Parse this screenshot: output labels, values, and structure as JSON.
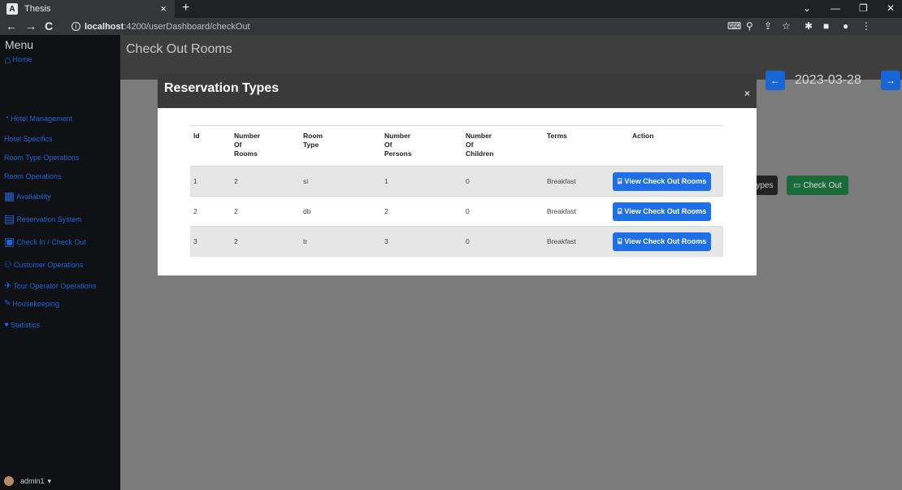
{
  "browser": {
    "tab_title": "Thesis",
    "tab_favicon": "A",
    "tab_close": "×",
    "new_tab": "+",
    "url_host": "localhost",
    "url_path": ":4200/userDashboard/checkOut",
    "window_min": "—",
    "window_restore": "❐",
    "window_close": "✕",
    "chevron": "⌄"
  },
  "sidebar": {
    "menu_title": "Menu",
    "items": [
      {
        "label": "Home",
        "icon": "home-icon"
      },
      {
        "label": "Hotel Management",
        "icon": "dashboard-icon"
      },
      {
        "label": "Hotel Specifics",
        "icon": ""
      },
      {
        "label": "Room Type Operations",
        "icon": ""
      },
      {
        "label": "Room Operations",
        "icon": ""
      },
      {
        "label": "Availability",
        "icon": "grid-icon"
      },
      {
        "label": "Reservation System",
        "icon": "calendar-icon"
      },
      {
        "label": "Check In / Check Out",
        "icon": "key-icon"
      },
      {
        "label": "Customer Operations",
        "icon": "users-icon"
      },
      {
        "label": "Tour Operator Operations",
        "icon": "plane-icon"
      },
      {
        "label": "Housekeeping",
        "icon": "broom-icon"
      },
      {
        "label": "Statistics",
        "icon": "chart-icon"
      }
    ],
    "user": "admin1"
  },
  "page": {
    "title": "Check Out Rooms",
    "date": "2023-03-28",
    "types_button": "Types",
    "checkout_button": "Check Out"
  },
  "modal": {
    "title": "Reservation Types",
    "close": "×",
    "columns": [
      "Id",
      "Number Of Rooms",
      "Room Type",
      "Number Of Persons",
      "Number Of Children",
      "Terms",
      "Action"
    ],
    "rows": [
      {
        "id": "1",
        "rooms": "2",
        "type": "si",
        "persons": "1",
        "children": "0",
        "terms": "Breakfast",
        "action": "View Check Out Rooms"
      },
      {
        "id": "2",
        "rooms": "2",
        "type": "db",
        "persons": "2",
        "children": "0",
        "terms": "Breakfast",
        "action": "View Check Out Rooms"
      },
      {
        "id": "3",
        "rooms": "2",
        "type": "tr",
        "persons": "3",
        "children": "0",
        "terms": "Breakfast",
        "action": "View Check Out Rooms"
      }
    ]
  },
  "colors": {
    "accent_blue": "#1f6fe8",
    "sidebar_link": "#1f62d8",
    "success_green": "#1b6b3a"
  }
}
